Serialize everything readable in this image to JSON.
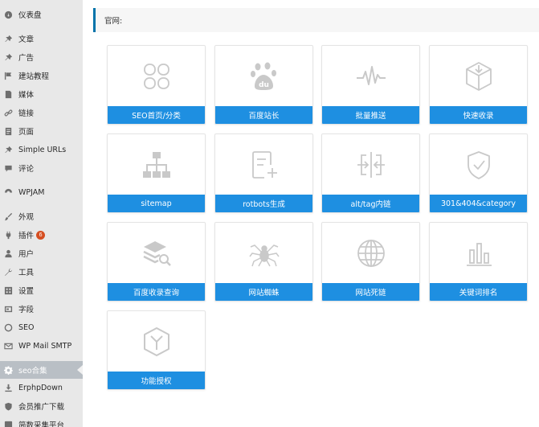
{
  "sidebar": {
    "items": [
      {
        "label": "仪表盘",
        "icon": "dashboard-icon"
      },
      {
        "label": "文章",
        "icon": "pin-icon"
      },
      {
        "label": "广告",
        "icon": "pin-icon"
      },
      {
        "label": "建站教程",
        "icon": "flag-icon"
      },
      {
        "label": "媒体",
        "icon": "media-icon"
      },
      {
        "label": "链接",
        "icon": "link-icon"
      },
      {
        "label": "页面",
        "icon": "page-icon"
      },
      {
        "label": "Simple URLs",
        "icon": "pin-icon"
      },
      {
        "label": "评论",
        "icon": "comment-icon"
      },
      {
        "label": "WPJAM",
        "icon": "wpjam-icon"
      },
      {
        "label": "外观",
        "icon": "brush-icon"
      },
      {
        "label": "插件",
        "icon": "plugin-icon",
        "badge": "6"
      },
      {
        "label": "用户",
        "icon": "user-icon"
      },
      {
        "label": "工具",
        "icon": "wrench-icon"
      },
      {
        "label": "设置",
        "icon": "settings-icon"
      },
      {
        "label": "字段",
        "icon": "field-icon"
      },
      {
        "label": "SEO",
        "icon": "seo-icon"
      },
      {
        "label": "WP Mail SMTP",
        "icon": "mail-icon"
      },
      {
        "label": "seo合集",
        "icon": "gear-icon",
        "active": true
      },
      {
        "label": "ErphpDown",
        "icon": "download-icon"
      },
      {
        "label": "会员推广下载",
        "icon": "shield-icon"
      },
      {
        "label": "简数采集平台",
        "icon": "collect-icon"
      }
    ]
  },
  "header": {
    "title": "官网:"
  },
  "cards": [
    {
      "label": "SEO首页/分类",
      "icon": "four-petal-icon"
    },
    {
      "label": "百度站长",
      "icon": "baidu-paw-icon"
    },
    {
      "label": "批量推送",
      "icon": "pulse-icon"
    },
    {
      "label": "快速收录",
      "icon": "box-download-icon"
    },
    {
      "label": "sitemap",
      "icon": "sitemap-icon"
    },
    {
      "label": "rotbots生成",
      "icon": "doc-plus-icon"
    },
    {
      "label": "alt/tag内链",
      "icon": "link-arrows-icon"
    },
    {
      "label": "301&404&category",
      "icon": "shield-check-icon"
    },
    {
      "label": "百度收录查询",
      "icon": "layers-search-icon"
    },
    {
      "label": "网站蜘蛛",
      "icon": "spider-icon"
    },
    {
      "label": "网站死链",
      "icon": "globe-icon"
    },
    {
      "label": "关键词排名",
      "icon": "bar-chart-icon"
    },
    {
      "label": "功能授权",
      "icon": "hexagon-y-icon"
    }
  ],
  "colors": {
    "accent": "#1e8fe1",
    "sidebar_active": "#b9bfc5",
    "badge": "#d54e21",
    "icon_gray": "#c8c8c8"
  }
}
